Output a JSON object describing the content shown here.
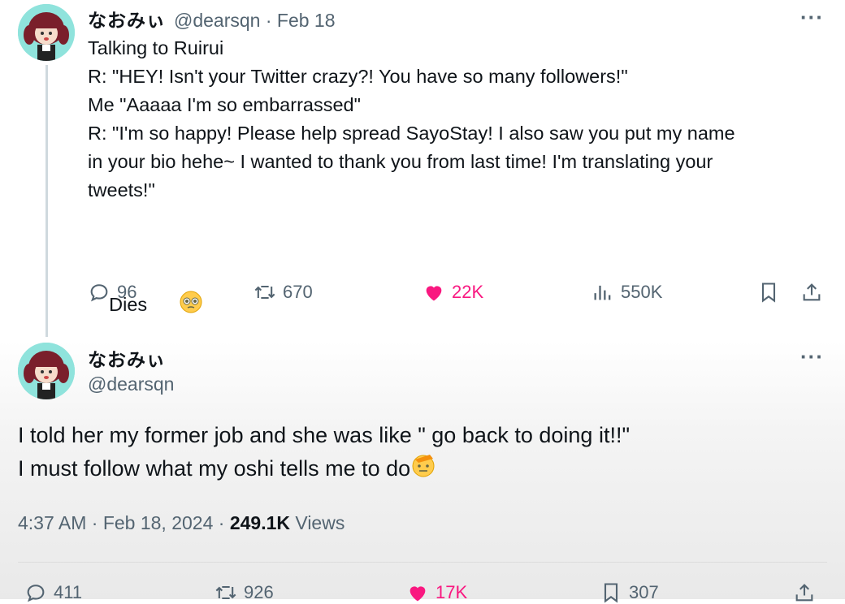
{
  "tweet1": {
    "display_name": "なおみぃ",
    "handle_date": "@dearsqn · Feb 18",
    "lines": [
      "Talking to Ruirui",
      "R: \"HEY! Isn't your Twitter crazy?! You have so many followers!\"",
      "Me \"Aaaaa I'm so embarrassed\"",
      "R: \"I'm so happy! Please help spread SayoStay! I also saw you put my name",
      "in your bio hehe~ I wanted to thank you from last time! I'm translating your",
      "tweets!\"",
      "",
      "Dies"
    ],
    "emoji": "pleading-face-emoji",
    "actions": {
      "replies": "96",
      "retweets": "670",
      "likes": "22K",
      "views": "550K"
    },
    "like_color": "#f91880"
  },
  "tweet2": {
    "display_name": "なおみぃ",
    "handle": "@dearsqn",
    "lines": [
      "I told her my former job and she was like \" go back to doing it!!\"",
      "I must follow what my oshi tells me to do"
    ],
    "emoji": "saluting-face-emoji",
    "time": "4:37 AM · Feb 18, 2024 · ",
    "views_count": "249.1K",
    "views_label": " Views",
    "actions": {
      "replies": "411",
      "retweets": "926",
      "likes": "17K",
      "bookmarks": "307"
    }
  },
  "icons": [
    "more-icon",
    "reply-icon",
    "retweet-icon",
    "like-icon",
    "views-icon",
    "bookmark-icon",
    "share-icon"
  ]
}
